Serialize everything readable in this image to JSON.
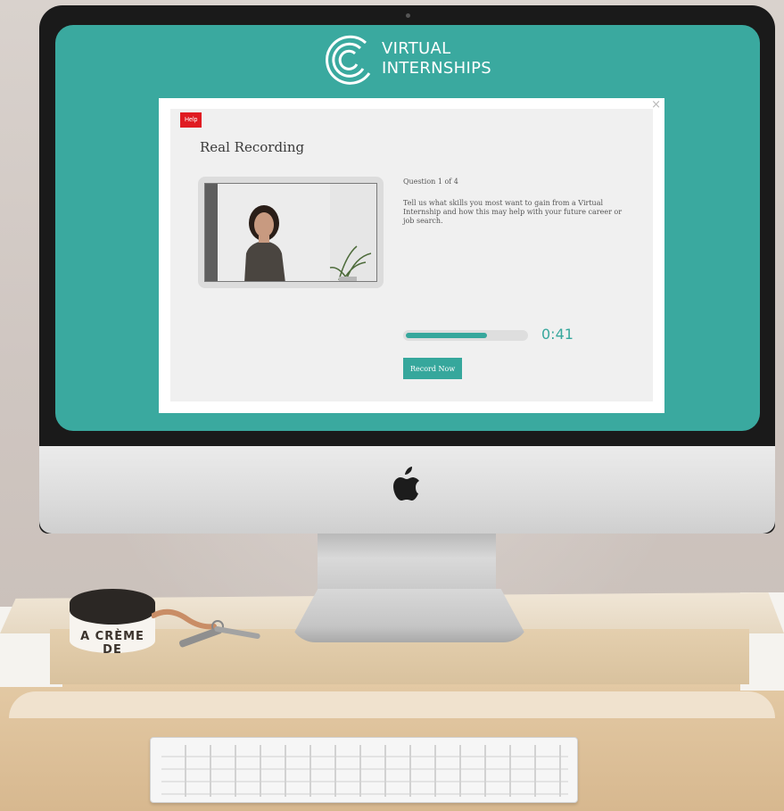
{
  "brand": {
    "line1": "VIRTUAL",
    "line2": "INTERNSHIPS"
  },
  "modal": {
    "close_glyph": "×",
    "help_label": "Help",
    "title": "Real Recording",
    "question_count": "Question 1 of 4",
    "question_text": "Tell us what skills you most want to gain from a Virtual Internship and how this may help with your future career or job search.",
    "timer": "0:41",
    "progress_fraction": 0.68,
    "record_label": "Record Now"
  },
  "props": {
    "jar_label": "A CRÈME DE"
  },
  "colors": {
    "screen_bg": "#3aa99f",
    "accent": "#36a79c",
    "help_red": "#e01b22"
  },
  "icons": {
    "logo": "virtual-internships-logo-icon",
    "close": "close-icon",
    "apple": "apple-logo-icon"
  }
}
